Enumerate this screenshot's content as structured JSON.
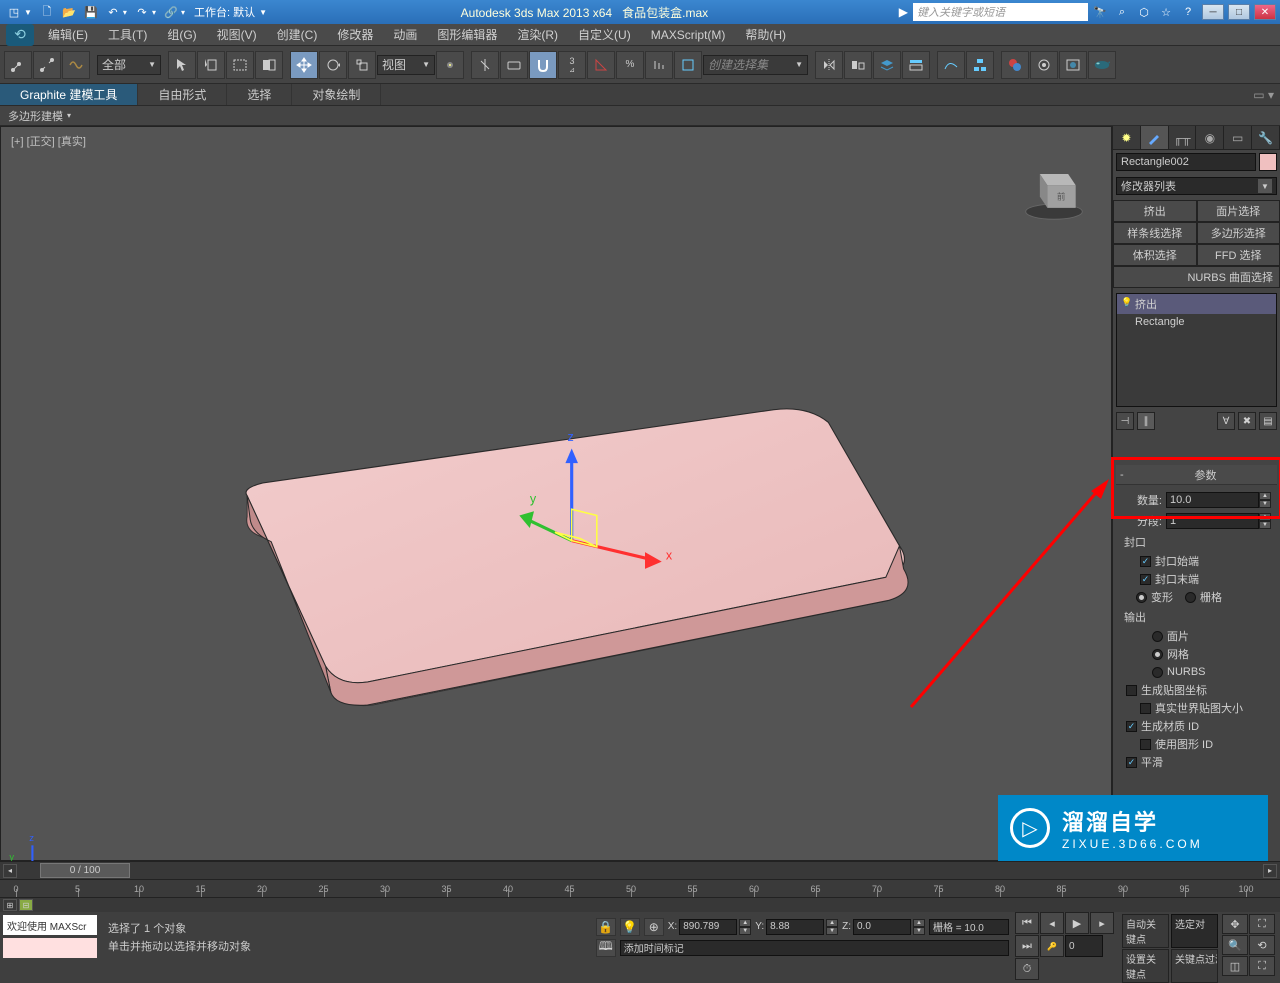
{
  "titlebar": {
    "workspace_label": "工作台: 默认",
    "app_title_left": "Autodesk 3ds Max  2013 x64",
    "file_title": "食品包装盒.max",
    "search_placeholder": "键入关键字或短语"
  },
  "menus": [
    "编辑(E)",
    "工具(T)",
    "组(G)",
    "视图(V)",
    "创建(C)",
    "修改器",
    "动画",
    "图形编辑器",
    "渲染(R)",
    "自定义(U)",
    "MAXScript(M)",
    "帮助(H)"
  ],
  "toolbar": {
    "filter_all": "全部",
    "view_label": "视图",
    "selset_label": "创建选择集"
  },
  "ribbon": {
    "tabs": [
      "Graphite 建模工具",
      "自由形式",
      "选择",
      "对象绘制"
    ],
    "sub": "多边形建模"
  },
  "viewport": {
    "label": "[+] [正交] [真实]"
  },
  "command_panel": {
    "object_name": "Rectangle002",
    "mod_list_label": "修改器列表",
    "mod_buttons": [
      "挤出",
      "面片选择",
      "样条线选择",
      "多边形选择",
      "体积选择",
      "FFD 选择"
    ],
    "nurbs_btn": "NURBS 曲面选择",
    "stack": [
      "挤出",
      "Rectangle"
    ],
    "rollout": {
      "title": "参数",
      "amount_label": "数量:",
      "amount_value": "10.0",
      "segments_label": "分段:",
      "segments_value": "1",
      "cap_title": "封口",
      "cap_start": "封口始端",
      "cap_end": "封口末端",
      "morph": "变形",
      "grid": "栅格",
      "output_title": "输出",
      "patch": "面片",
      "mesh": "网格",
      "nurbs": "NURBS",
      "gen_mapping": "生成贴图坐标",
      "real_world": "真实世界贴图大小",
      "gen_matid": "生成材质 ID",
      "use_shapeid": "使用图形 ID",
      "smooth": "平滑"
    }
  },
  "status": {
    "sel_text": "选择了 1 个对象",
    "hint_text": "单击并拖动以选择并移动对象",
    "x_val": "890.789",
    "y_val": "8.88",
    "z_val": "0.0",
    "grid_text": "栅格 = 10.0",
    "add_time_tag": "添加时间标记",
    "auto_key": "自动关键点",
    "set_key": "设置关键点",
    "selected": "选定对",
    "key_filter": "关键点过滤器...",
    "timeslider": "0 / 100",
    "script_box": "欢迎使用  MAXScr",
    "frame_input": "0"
  },
  "timeline": {
    "ticks": [
      0,
      5,
      10,
      15,
      20,
      25,
      30,
      35,
      40,
      45,
      50,
      55,
      60,
      65,
      70,
      75,
      80,
      85,
      90,
      95,
      100
    ]
  },
  "watermark": {
    "brand": "溜溜自学",
    "url": "ZIXUE.3D66.COM"
  }
}
